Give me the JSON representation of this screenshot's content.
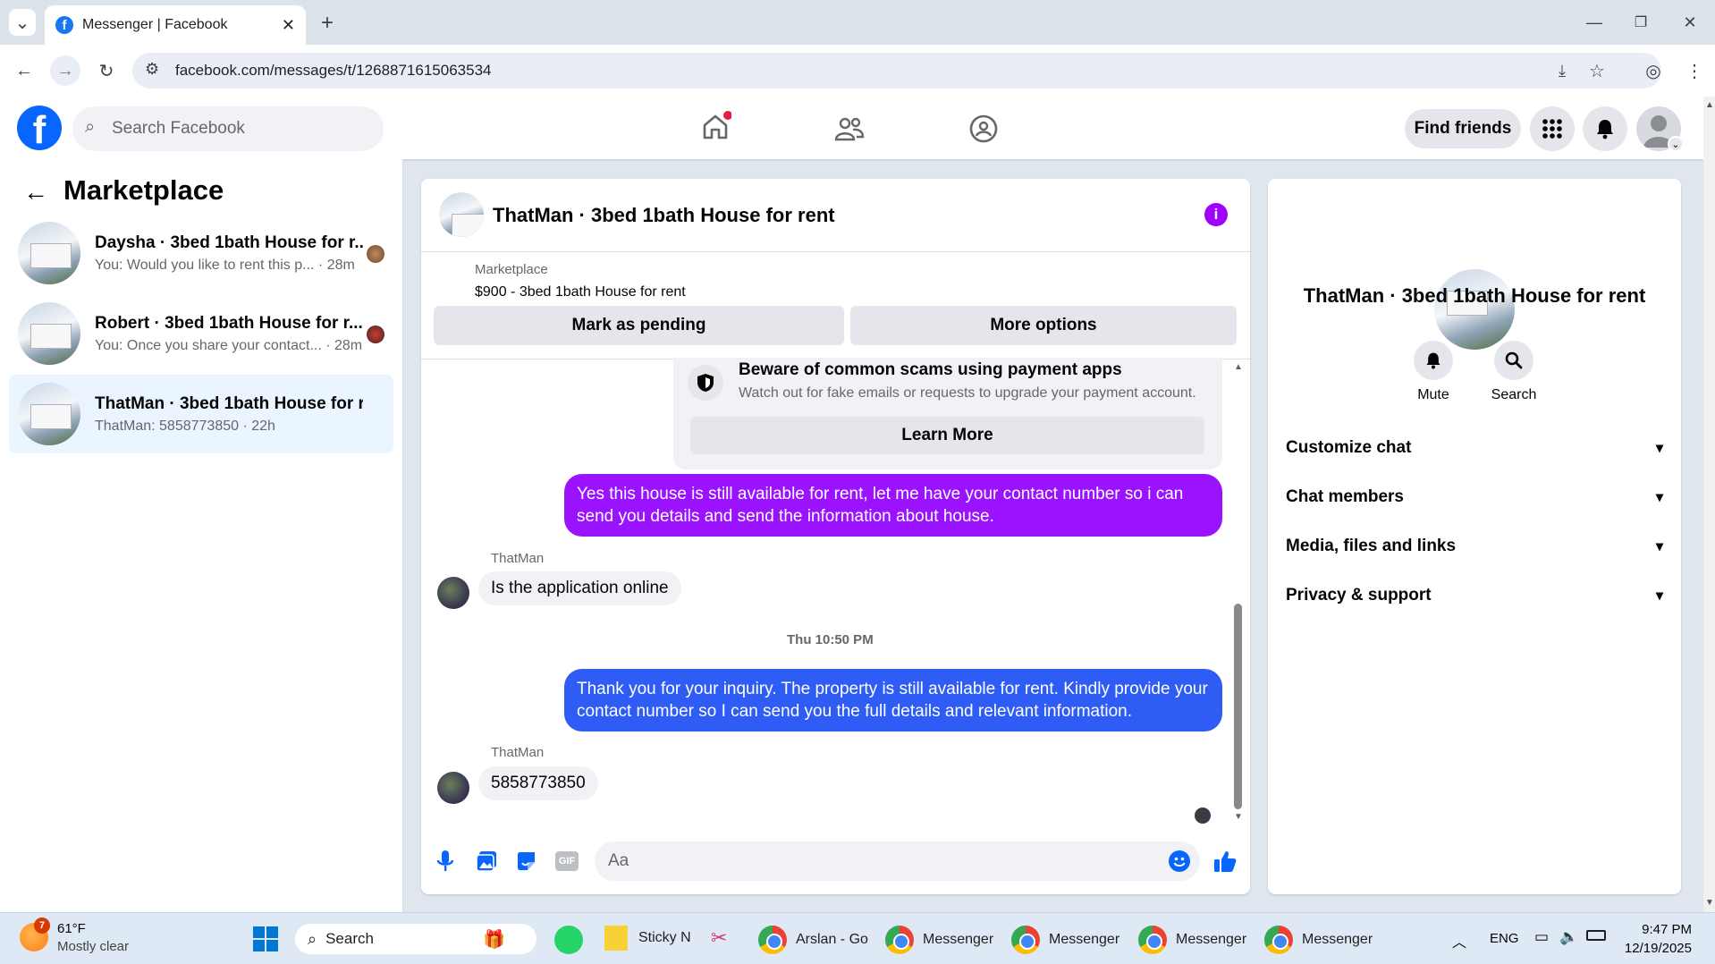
{
  "browser": {
    "tab_title": "Messenger | Facebook",
    "url": "facebook.com/messages/t/1268871615063534"
  },
  "fb_header": {
    "search_placeholder": "Search Facebook",
    "find_friends": "Find friends"
  },
  "left": {
    "title": "Marketplace",
    "conversations": [
      {
        "name": "Daysha · 3bed 1bath House for r...",
        "snippet": "You: Would you like to rent this p... · 28m"
      },
      {
        "name": "Robert · 3bed 1bath House for r...",
        "snippet": "You: Once you share your contact... · 28m"
      },
      {
        "name": "ThatMan · 3bed 1bath House for r...",
        "snippet": "ThatMan: 5858773850 · 22h"
      }
    ]
  },
  "chat": {
    "title": "ThatMan · 3bed 1bath House for rent",
    "marketplace_label": "Marketplace",
    "listing": "$900 - 3bed 1bath House for rent",
    "mark_pending": "Mark as pending",
    "more_options": "More options",
    "scam_title": "Beware of common scams using payment apps",
    "scam_desc": "Watch out for fake emails or requests to upgrade your payment account.",
    "learn_more": "Learn More",
    "messages": [
      {
        "dir": "out",
        "text": "Yes this house is still available for rent, let me have your contact number so i can send you details and send the information about house."
      },
      {
        "dir": "in",
        "sender": "ThatMan",
        "text": "Is the application online"
      },
      {
        "dir": "out",
        "text": "Thank you for your inquiry. The property is still available for rent. Kindly provide your contact number so I can send you the full details and relevant information."
      },
      {
        "dir": "in",
        "sender": "ThatMan",
        "text": "5858773850"
      }
    ],
    "timestamp": "Thu 10:50 PM",
    "composer_placeholder": "Aa"
  },
  "right": {
    "title": "ThatMan · 3bed 1bath House for rent",
    "mute": "Mute",
    "search": "Search",
    "rows": [
      "Customize chat",
      "Chat members",
      "Media, files and links",
      "Privacy & support"
    ]
  },
  "taskbar": {
    "weather_temp": "61°F",
    "weather_desc": "Mostly clear",
    "weather_badge": "7",
    "search": "Search",
    "sticky": "Sticky N",
    "arslan": "Arslan - Go",
    "messenger": "Messenger",
    "lang": "ENG",
    "time": "9:47 PM",
    "date": "12/19/2025"
  },
  "colors": {
    "fb_blue": "#0866ff",
    "bubble_purple": "#9b12ff",
    "bubble_blue": "#2f5cf5",
    "info_purple": "#a100ff",
    "active_row": "#ebf5ff"
  }
}
